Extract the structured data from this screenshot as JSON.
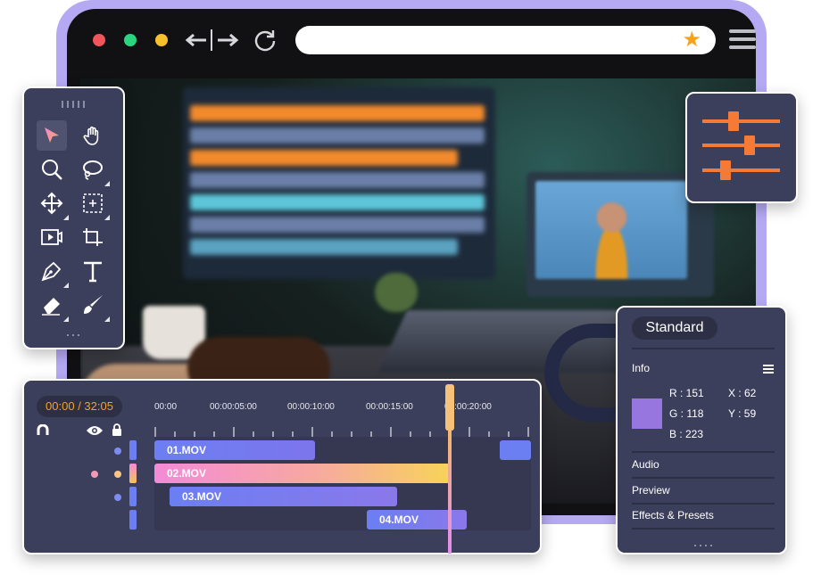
{
  "browser": {
    "window_buttons": [
      {
        "name": "close",
        "color": "#f2545b"
      },
      {
        "name": "minimize",
        "color": "#2bd47f"
      },
      {
        "name": "maximize",
        "color": "#f7c12b"
      }
    ],
    "url_value": "",
    "bookmark_icon": "star-icon",
    "accent": "#b6a9f4"
  },
  "tools": {
    "items": [
      {
        "name": "select-tool",
        "icon": "arrow-pointer-icon",
        "selected": true
      },
      {
        "name": "hand-tool",
        "icon": "hand-icon"
      },
      {
        "name": "zoom-tool",
        "icon": "magnifier-icon"
      },
      {
        "name": "lasso-tool",
        "icon": "lasso-icon"
      },
      {
        "name": "move-tool",
        "icon": "move-arrows-icon"
      },
      {
        "name": "transform-tool",
        "icon": "transform-icon"
      },
      {
        "name": "video-tool",
        "icon": "video-icon"
      },
      {
        "name": "crop-tool",
        "icon": "crop-icon"
      },
      {
        "name": "pen-tool",
        "icon": "pen-icon"
      },
      {
        "name": "text-tool",
        "icon": "text-icon"
      },
      {
        "name": "eraser-tool",
        "icon": "eraser-icon"
      },
      {
        "name": "brush-tool",
        "icon": "brush-icon"
      }
    ]
  },
  "adjust": {
    "icon": "sliders-icon",
    "levels": [
      0.4,
      0.6,
      0.3
    ],
    "color": "#f57a35"
  },
  "timeline": {
    "timecode": "00:00 / 32:05",
    "ticks": [
      "00:00",
      "00:00:05:00",
      "00:00:10:00",
      "00:00:15:00",
      "00:00:20:00"
    ],
    "header_icons": [
      "magnet-icon",
      "eye-icon",
      "lock-icon"
    ],
    "clips": [
      {
        "label": "01.MOV",
        "track": 1
      },
      {
        "label": "02.MOV",
        "track": 2
      },
      {
        "label": "03.MOV",
        "track": 3
      },
      {
        "label": "04.MOV",
        "track": 4
      }
    ],
    "playhead_color": "#f6b87a"
  },
  "info_panel": {
    "mode": "Standard",
    "info_label": "Info",
    "rgb": {
      "r": "R : 151",
      "g": "G : 118",
      "b": "B : 223"
    },
    "coords": {
      "x": "X : 62",
      "y": "Y : 59"
    },
    "swatch_color": "#9776df",
    "sections": [
      "Audio",
      "Preview",
      "Effects & Presets"
    ]
  }
}
